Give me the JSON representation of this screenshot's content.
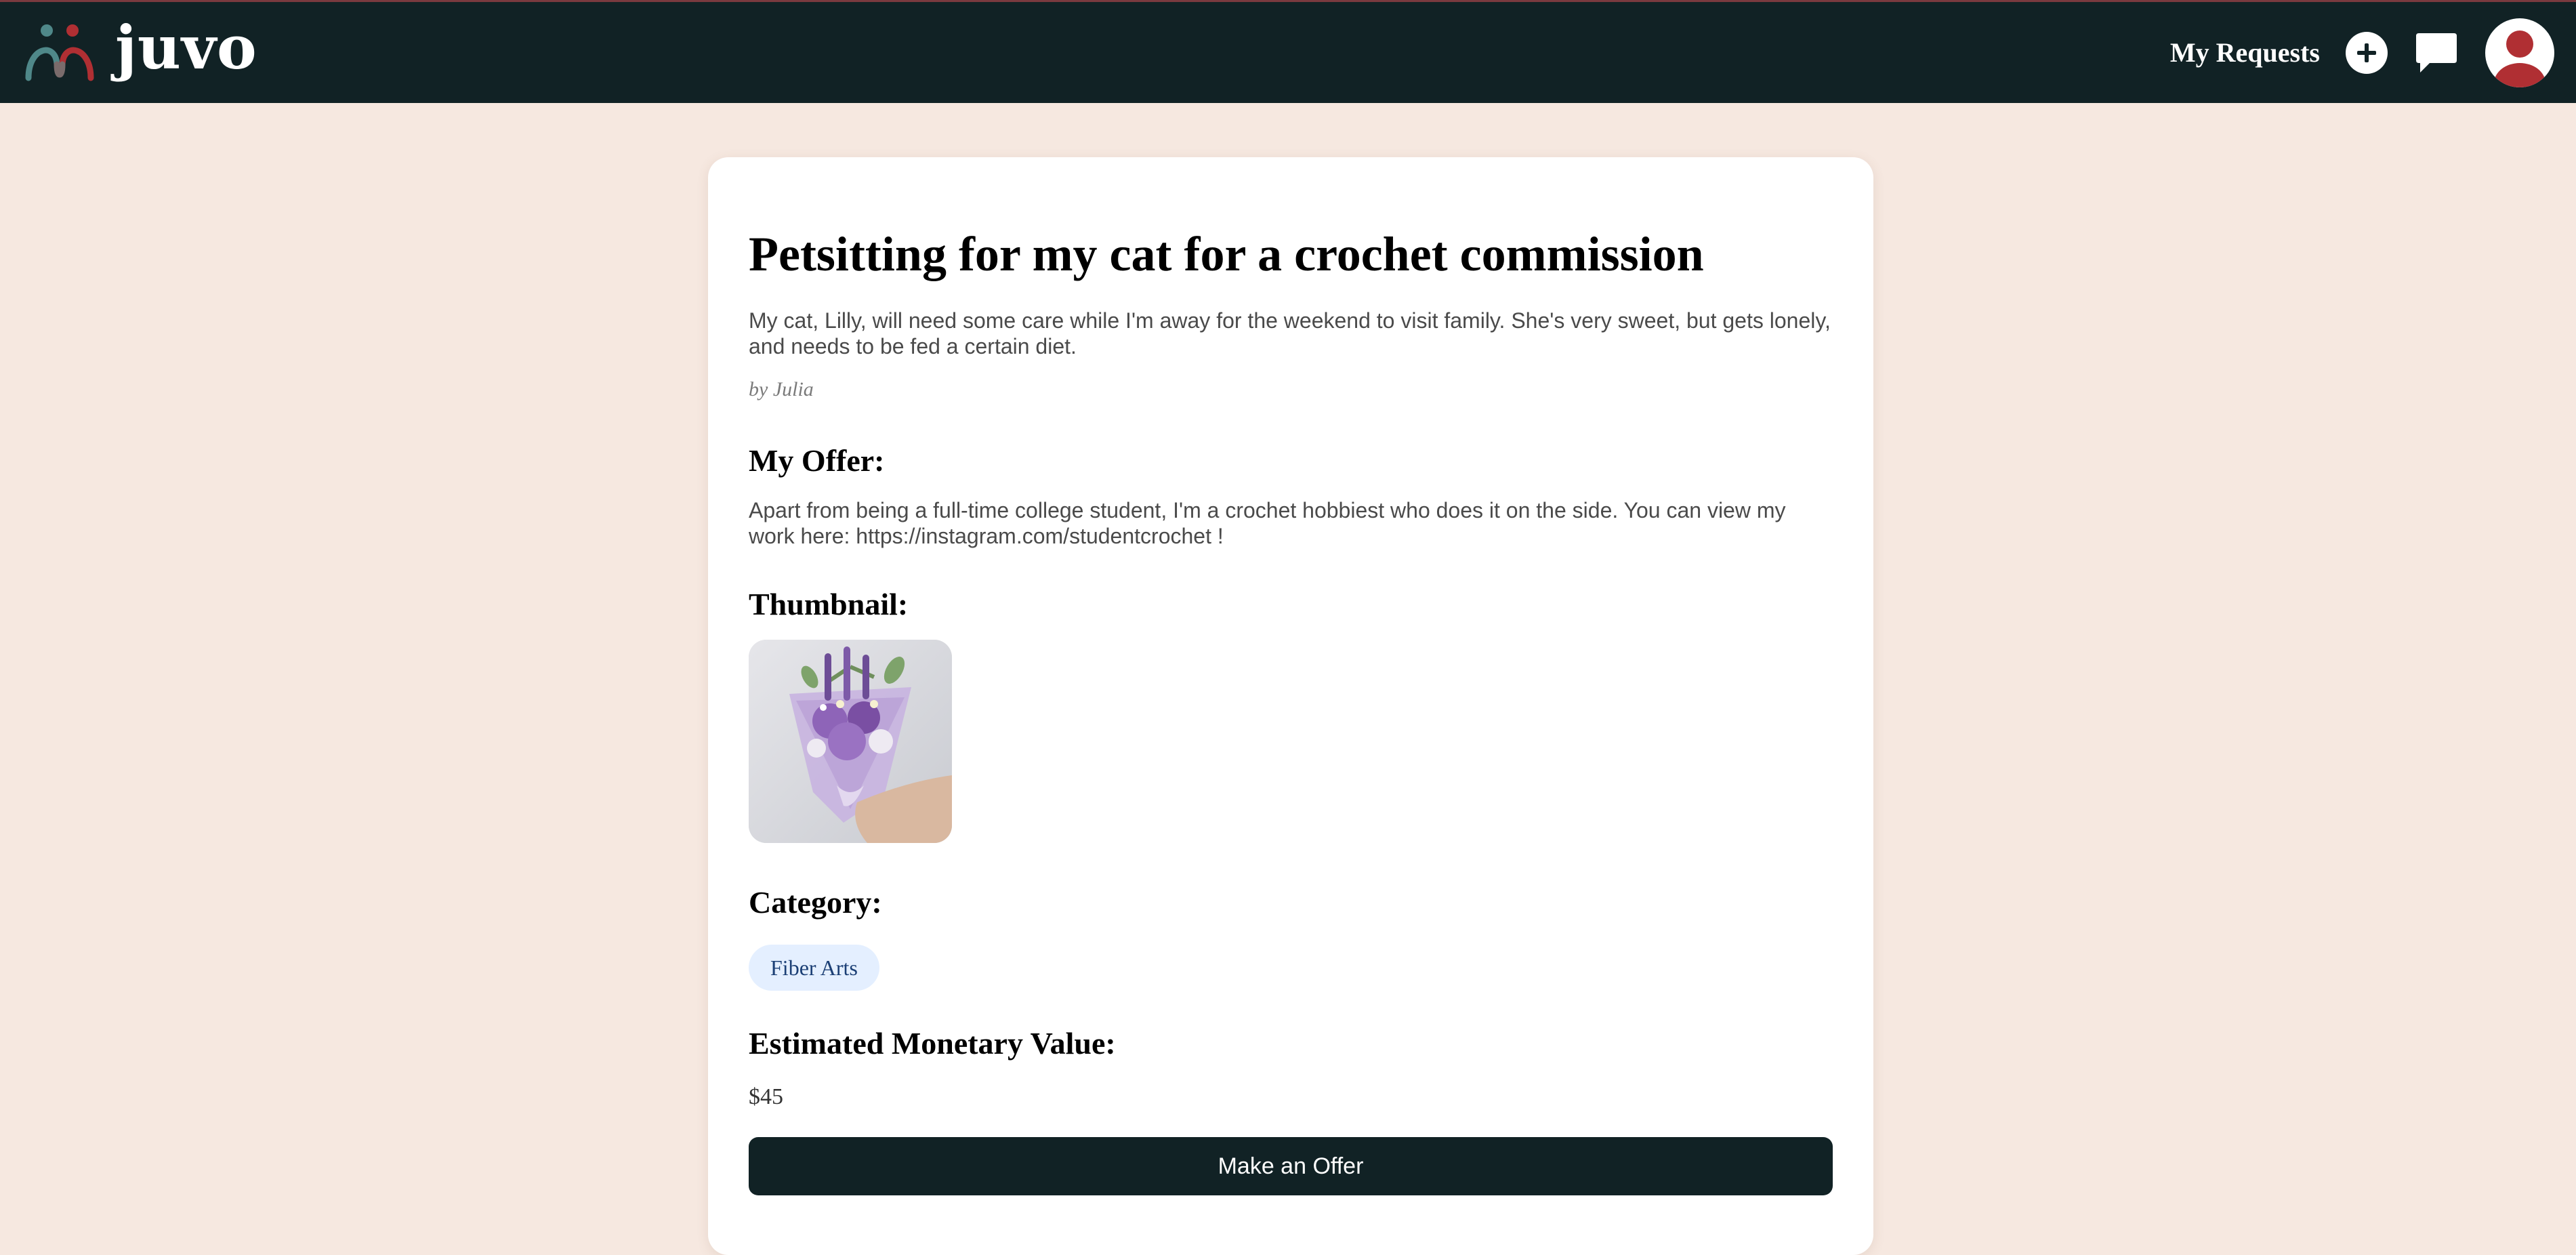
{
  "header": {
    "app_name": "juvo",
    "nav_my_requests": "My Requests",
    "icons": [
      "people-logo-icon",
      "plus-icon",
      "chat-bubble-icon",
      "user-avatar-icon"
    ],
    "colors": {
      "bar": "#112225",
      "accent_red": "#b02f33",
      "accent_teal": "#4f8889"
    }
  },
  "listing": {
    "title": "Petsitting for my cat for a crochet commission",
    "description": "My cat, Lilly, will need some care while I'm away for the weekend to visit family. She's very sweet, but gets lonely, and needs to be fed a certain diet.",
    "author": "by Julia",
    "offer_heading": "My Offer:",
    "offer_text": "Apart from being a full-time college student, I'm a crochet hobbiest who does it on the side. You can view my work here: https://instagram.com/studentcrochet !",
    "thumbnail_heading": "Thumbnail:",
    "category_heading": "Category:",
    "category": "Fiber Arts",
    "value_heading": "Estimated Monetary Value:",
    "value": "$45",
    "cta_label": "Make an Offer"
  }
}
